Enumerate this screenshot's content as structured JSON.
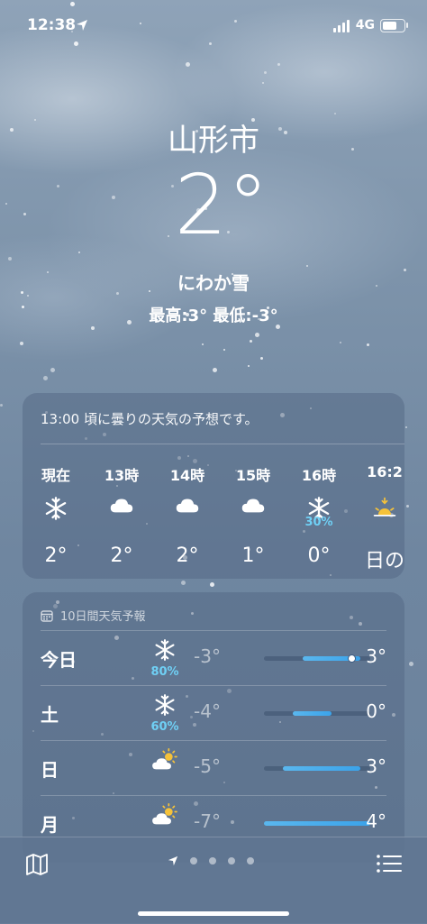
{
  "status_bar": {
    "time": "12:38",
    "network": "4G",
    "battery_level": 0.8
  },
  "weather": {
    "city": "山形市",
    "temperature": "2°",
    "condition": "にわか雪",
    "high_low": "最高:3°  最低:-3°"
  },
  "hourly": {
    "summary": "13:00 頃に曇りの天気の予想です。",
    "items": [
      {
        "label": "現在",
        "icon": "snowflake-icon",
        "precip": "",
        "temp": "2°"
      },
      {
        "label": "13時",
        "icon": "cloud-icon",
        "precip": "",
        "temp": "2°"
      },
      {
        "label": "14時",
        "icon": "cloud-icon",
        "precip": "",
        "temp": "2°"
      },
      {
        "label": "15時",
        "icon": "cloud-icon",
        "precip": "",
        "temp": "1°"
      },
      {
        "label": "16時",
        "icon": "snowflake-icon",
        "precip": "30%",
        "temp": "0°"
      },
      {
        "label": "16:2",
        "icon": "sunset-icon",
        "precip": "",
        "temp": "日の"
      }
    ]
  },
  "daily": {
    "header": "10日間天気予報",
    "range_min": -7,
    "range_max": 4,
    "days": [
      {
        "day": "今日",
        "icon": "snowflake-icon",
        "precip": "80%",
        "low": "-3°",
        "high": "3°",
        "low_value": -3,
        "high_value": 3,
        "current": 2
      },
      {
        "day": "土",
        "icon": "snowflake-icon",
        "precip": "60%",
        "low": "-4°",
        "high": "0°",
        "low_value": -4,
        "high_value": 0
      },
      {
        "day": "日",
        "icon": "partly-sunny-icon",
        "precip": "",
        "low": "-5°",
        "high": "3°",
        "low_value": -5,
        "high_value": 3
      },
      {
        "day": "月",
        "icon": "partly-sunny-icon",
        "precip": "",
        "low": "-7°",
        "high": "4°",
        "low_value": -7,
        "high_value": 4
      }
    ]
  },
  "bottom_bar": {
    "page_count": 4,
    "current_page": "location"
  },
  "colors": {
    "precip": "#6fd0f5",
    "bar": "#3ba3ea",
    "sun": "#f5c23a"
  }
}
